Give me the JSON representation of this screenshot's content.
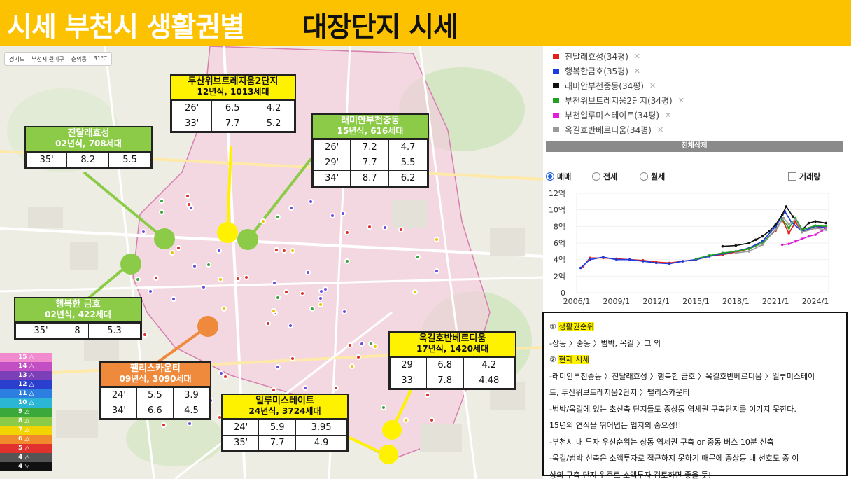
{
  "header": {
    "title_left": "시세 부천시 생활권별",
    "title_right": "대장단지 시세"
  },
  "map": {
    "topbar": [
      "경기도",
      "부천시 원미구",
      "춘의동",
      "31℃"
    ],
    "boxes": [
      {
        "id": "dusan",
        "title": "두산위브트레지움2단지",
        "subtitle": "12년식, 1013세대",
        "style": "yellow",
        "rows": [
          [
            "26'",
            "6.5",
            "4.2"
          ],
          [
            "33'",
            "7.7",
            "5.2"
          ]
        ]
      },
      {
        "id": "raemian",
        "title": "래미안부천중동",
        "subtitle": "15년식, 616세대",
        "style": "green",
        "rows": [
          [
            "26'",
            "7.2",
            "4.7"
          ],
          [
            "29'",
            "7.7",
            "5.5"
          ],
          [
            "34'",
            "8.7",
            "6.2"
          ]
        ]
      },
      {
        "id": "jindal",
        "title": "진달래효성",
        "subtitle": "02년식, 708세대",
        "style": "green",
        "rows": [
          [
            "35'",
            "8.2",
            "5.5"
          ]
        ]
      },
      {
        "id": "haengbok",
        "title": "행복한 금호",
        "subtitle": "02년식, 422세대",
        "style": "green",
        "rows": [
          [
            "35'",
            "8",
            "5.3"
          ]
        ]
      },
      {
        "id": "palace",
        "title": "팰리스카운티",
        "subtitle": "09년식, 3090세대",
        "style": "orange",
        "rows": [
          [
            "24'",
            "5.5",
            "3.9"
          ],
          [
            "34'",
            "6.6",
            "4.5"
          ]
        ]
      },
      {
        "id": "okgil",
        "title": "옥길호반베르디움",
        "subtitle": "17년식, 1420세대",
        "style": "yellow",
        "rows": [
          [
            "29'",
            "6.8",
            "4.2"
          ],
          [
            "33'",
            "7.8",
            "4.48"
          ]
        ]
      },
      {
        "id": "ilru",
        "title": "일루미스테이트",
        "subtitle": "24년식, 3724세대",
        "style": "yellow",
        "rows": [
          [
            "24'",
            "5.9",
            "3.95"
          ],
          [
            "35'",
            "7.7",
            "4.9"
          ]
        ]
      }
    ],
    "legend": [
      {
        "label": "15 △",
        "color": "#f28ad0"
      },
      {
        "label": "14 △",
        "color": "#c24fc4"
      },
      {
        "label": "13 △",
        "color": "#7b3fb8"
      },
      {
        "label": "12 △",
        "color": "#2b3fcf"
      },
      {
        "label": "11 △",
        "color": "#2c7fe0"
      },
      {
        "label": "10 △",
        "color": "#2bb6d6"
      },
      {
        "label": "9 △",
        "color": "#3aa83a"
      },
      {
        "label": "8 △",
        "color": "#8ccb47"
      },
      {
        "label": "7 △",
        "color": "#f2d500"
      },
      {
        "label": "6 △",
        "color": "#f08a2c"
      },
      {
        "label": "5 △",
        "color": "#e0312d"
      },
      {
        "label": "4 △",
        "color": "#555555"
      },
      {
        "label": "4 ▽",
        "color": "#111111"
      }
    ]
  },
  "compare_list": [
    {
      "name": "진달래효성(34평)",
      "color": "#e0201b"
    },
    {
      "name": "행복한금호(35평)",
      "color": "#1c3be0"
    },
    {
      "name": "래미안부천중동(34평)",
      "color": "#111111"
    },
    {
      "name": "부천위브트레지움2단지(34평)",
      "color": "#21a021"
    },
    {
      "name": "부천일루미스테이트(34평)",
      "color": "#e020d8"
    },
    {
      "name": "옥길호반베르디움(34평)",
      "color": "#999999"
    }
  ],
  "delete_all_label": "전체삭제",
  "radios": {
    "sale": "매매",
    "jeonse": "전세",
    "monthly": "월세",
    "volume": "거래량"
  },
  "chart_data": {
    "type": "line",
    "x_ticks": [
      "2006/1",
      "2009/1",
      "2012/1",
      "2015/1",
      "2018/1",
      "2021/1",
      "2024/1"
    ],
    "y_ticks": [
      "0",
      "2억",
      "4억",
      "6억",
      "8억",
      "10억",
      "12억"
    ],
    "ylim": [
      0,
      12
    ],
    "xlim": [
      2006,
      2025
    ],
    "series": [
      {
        "name": "진달래효성(34평)",
        "color": "#e0201b",
        "x": [
          2006.5,
          2007,
          2008,
          2009,
          2010,
          2011,
          2012,
          2013,
          2014,
          2015,
          2016,
          2017,
          2018,
          2019,
          2020,
          2021,
          2021.5,
          2022,
          2022.5,
          2023,
          2024,
          2024.8
        ],
        "y": [
          3.2,
          4.2,
          4.2,
          4.1,
          4.0,
          3.9,
          3.7,
          3.6,
          3.8,
          4.0,
          4.4,
          4.6,
          4.9,
          5.3,
          6.0,
          7.5,
          8.8,
          7.2,
          8.5,
          7.3,
          7.8,
          7.9
        ]
      },
      {
        "name": "행복한금호(35평)",
        "color": "#1c3be0",
        "x": [
          2006.3,
          2007,
          2008,
          2009,
          2010,
          2011,
          2012,
          2013,
          2014,
          2015,
          2016,
          2017,
          2018,
          2019,
          2020,
          2021,
          2021.7,
          2022.2,
          2023,
          2024,
          2024.8
        ],
        "y": [
          3.0,
          4.0,
          4.3,
          4.0,
          4.0,
          3.8,
          3.6,
          3.5,
          3.8,
          4.0,
          4.4,
          4.7,
          5.0,
          5.4,
          6.2,
          8.0,
          9.8,
          8.5,
          7.4,
          8.0,
          7.9
        ]
      },
      {
        "name": "래미안부천중동(34평)",
        "color": "#111111",
        "x": [
          2017,
          2018,
          2019,
          2019.5,
          2020,
          2020.5,
          2021,
          2021.5,
          2021.8,
          2022.3,
          2023,
          2023.5,
          2024,
          2024.8
        ],
        "y": [
          5.6,
          5.7,
          6.0,
          6.4,
          6.8,
          7.4,
          8.2,
          9.4,
          10.4,
          9.2,
          7.6,
          8.4,
          8.6,
          8.4
        ]
      },
      {
        "name": "부천위브트레지움2단지(34평)",
        "color": "#21a021",
        "x": [
          2015,
          2016,
          2017,
          2018,
          2019,
          2020,
          2021,
          2021.5,
          2022,
          2022.5,
          2023,
          2024,
          2024.8
        ],
        "y": [
          4.1,
          4.5,
          4.8,
          5.0,
          5.3,
          6.0,
          7.6,
          8.9,
          7.8,
          9.0,
          7.6,
          8.1,
          8.0
        ]
      },
      {
        "name": "부천일루미스테이트(34평)",
        "color": "#e020d8",
        "x": [
          2021.5,
          2022,
          2022.5,
          2023,
          2023.5,
          2024,
          2024.5,
          2024.8
        ],
        "y": [
          5.8,
          5.9,
          6.2,
          6.5,
          6.8,
          7.0,
          7.5,
          7.8
        ]
      },
      {
        "name": "옥길호반베르디움(34평)",
        "color": "#999999",
        "x": [
          2018,
          2019,
          2020,
          2021,
          2021.6,
          2022,
          2022.5,
          2023,
          2024,
          2024.8
        ],
        "y": [
          4.8,
          5.0,
          5.8,
          7.6,
          9.0,
          8.3,
          8.8,
          7.3,
          7.8,
          7.6
        ]
      }
    ]
  },
  "notes": {
    "n1_num": "①",
    "n1_title": "생활권순위",
    "n1_body": "-상동 〉중동 〉범박, 옥길 〉그 외",
    "n2_num": "②",
    "n2_title": "현재 시세",
    "n2_body1": "-래미안부천중동 〉진달래효성 〉행복한 금호 〉옥길호반베르디움 〉일루미스테이",
    "n2_body2": "트, 두산위브트레지움2단지 〉팰리스카운티",
    "n3": "-범박/옥길에 있는 초신축 단지들도 중상동 역세권 구축단지를 이기지 못한다.",
    "n4": "15년의 연식을 뛰어넘는 입지의 중요성!!",
    "n5": "-부천시 내 투자 우선순위는 상동 역세권 구축 or 중동 버스 10분 신축",
    "n6": "-옥길/범박 신축은 소액투자로 접근하지 못하기 때문에 중상동 내 선호도 중 이",
    "n7": "상의 구축 단지 위주로 소액투자 검토하면 좋을 듯!"
  }
}
